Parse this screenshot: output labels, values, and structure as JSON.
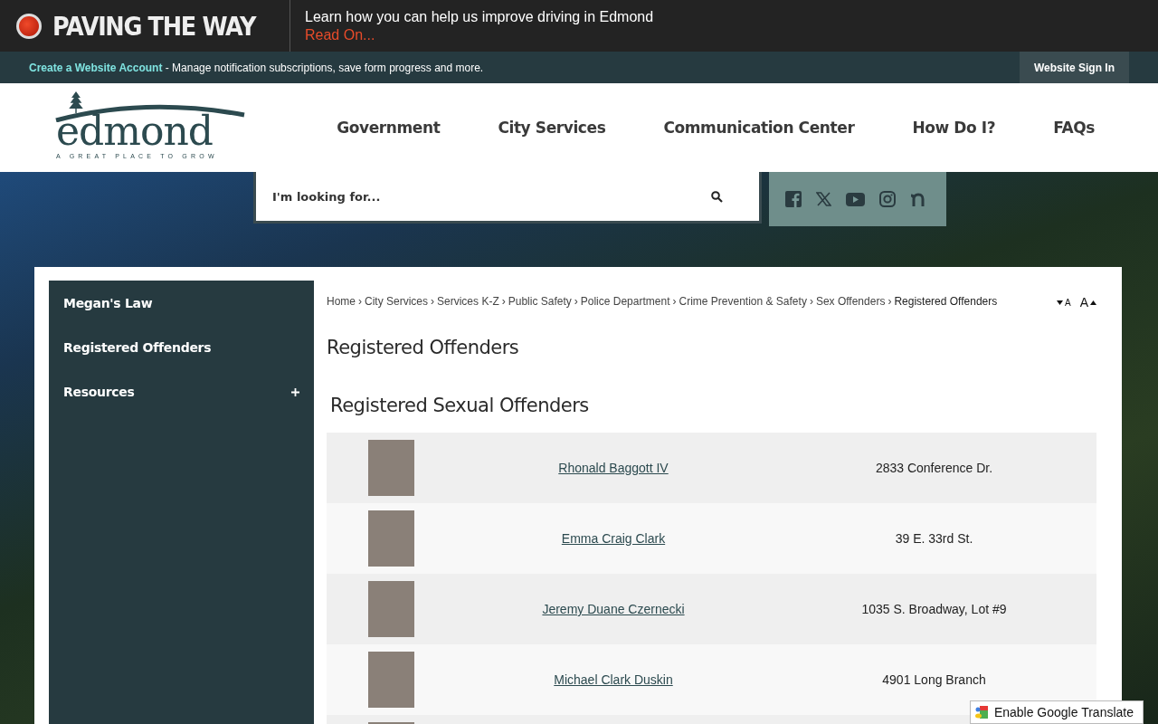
{
  "alert_bar": {
    "title": "PAVING THE WAY",
    "message": "Learn how you can help us improve driving in Edmond",
    "link": "Read On..."
  },
  "account_bar": {
    "link": "Create a Website Account",
    "text": " - Manage notification subscriptions, save form progress and more.",
    "sign_in": "Website Sign In"
  },
  "header": {
    "logo_word": "edmond",
    "logo_tagline": "A GREAT PLACE TO GROW",
    "nav": [
      "Government",
      "City Services",
      "Communication Center",
      "How Do I?",
      "FAQs"
    ]
  },
  "search": {
    "placeholder": "I'm looking for..."
  },
  "sidebar": {
    "items": [
      {
        "label": "Megan's Law",
        "expandable": false
      },
      {
        "label": "Registered Offenders",
        "expandable": false
      },
      {
        "label": "Resources",
        "expandable": true
      }
    ]
  },
  "breadcrumb": [
    {
      "label": "Home",
      "sep": "›"
    },
    {
      "label": "City Services",
      "sep": "›"
    },
    {
      "label": "Services K-Z",
      "sep": "›"
    },
    {
      "label": "Public Safety",
      "sep": "›"
    },
    {
      "label": "Police Department",
      "sep": "›"
    },
    {
      "label": "Crime Prevention & Safety",
      "sep": "›"
    },
    {
      "label": "Sex Offenders",
      "sep": "›"
    },
    {
      "label": "Registered Offenders"
    }
  ],
  "font_controls": [
    {
      "kind": "decrease",
      "label": "A"
    },
    {
      "kind": "increase",
      "label": "A"
    }
  ],
  "page_title": "Registered Offenders",
  "section_title": "Registered Sexual Offenders",
  "offenders": [
    {
      "name": "Rhonald Baggott IV",
      "address": "2833 Conference Dr."
    },
    {
      "name": "Emma Craig Clark",
      "address": "39 E. 33rd St."
    },
    {
      "name": "Jeremy Duane Czernecki",
      "address": "1035 S. Broadway, Lot #9"
    },
    {
      "name": "Michael Clark Duskin",
      "address": "4901 Long Branch"
    }
  ],
  "translate": {
    "label": "Enable Google Translate"
  }
}
